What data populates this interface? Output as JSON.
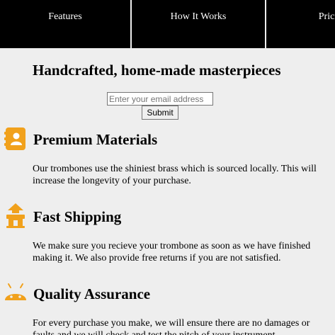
{
  "nav": {
    "items": [
      {
        "label": "Features"
      },
      {
        "label": "How It Works"
      },
      {
        "label": "Pricing"
      }
    ]
  },
  "hero": {
    "title": "Handcrafted, home-made masterpieces",
    "email_placeholder": "Enter your email address",
    "submit_label": "Submit"
  },
  "features": [
    {
      "icon": "address-book-icon",
      "title": "Premium Materials",
      "text": "Our trombones use the shiniest brass which is sourced locally. This will increase the longevity of your purchase."
    },
    {
      "icon": "shipping-truck-icon",
      "title": "Fast Shipping",
      "text": "We make sure you recieve your trombone as soon as we have finished making it. We also provide free returns if you are not satisfied."
    },
    {
      "icon": "android-icon",
      "title": "Quality Assurance",
      "text": "For every purchase you make, we will ensure there are no damages or faults and we will check and test the pitch of your instrument."
    }
  ],
  "colors": {
    "nav_background": "#000000",
    "page_background": "#eeeeee",
    "icon_accent": "#f1a11c"
  }
}
